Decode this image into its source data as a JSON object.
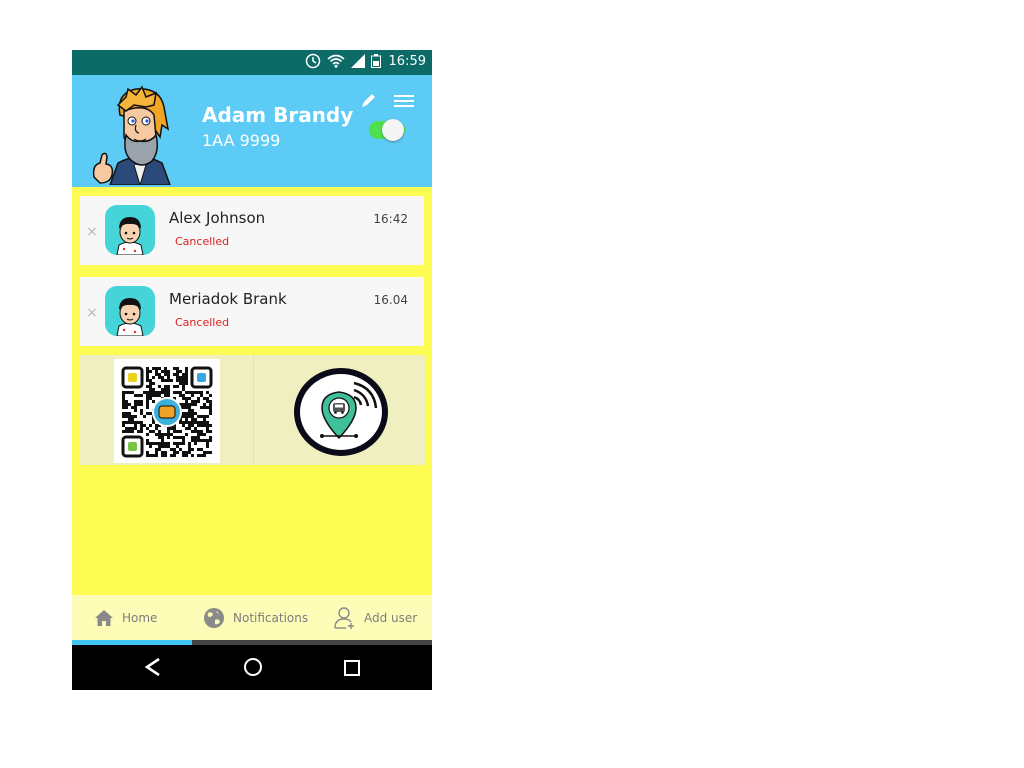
{
  "status_bar": {
    "time": "16:59",
    "icons": [
      "alarm-icon",
      "wifi-icon",
      "signal-icon",
      "battery-icon"
    ],
    "background": "#0c6b67"
  },
  "header": {
    "user_name": "Adam Brandy",
    "plate": "1AA 9999",
    "background": "#5ccbf5",
    "toggle_on": true,
    "edit_icon": "pencil-icon",
    "menu_icon": "hamburger-menu-icon"
  },
  "requests": [
    {
      "name": "Alex Johnson",
      "time": "16:42",
      "status": "Cancelled",
      "close": "×"
    },
    {
      "name": "Meriadok Brank",
      "time": "16.04",
      "status": "Cancelled",
      "close": "×"
    }
  ],
  "tabs": [
    {
      "label": "Home",
      "icon": "home-icon"
    },
    {
      "label": "Notifications",
      "icon": "globe-icon"
    },
    {
      "label": "Add user",
      "icon": "add-user-icon"
    }
  ],
  "active_tab": "Home",
  "nav": [
    "back-icon",
    "home-circle-icon",
    "recents-square-icon"
  ],
  "colors": {
    "content_bg": "#fcfc52",
    "cancelled": "#e02020",
    "accent": "#41c6f2",
    "toggle": "#4fe04f"
  }
}
